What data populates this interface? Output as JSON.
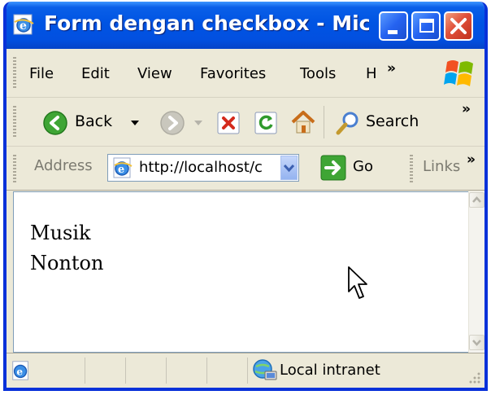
{
  "window": {
    "title": "Form dengan checkbox - Micr...",
    "title_bar_color": "#0054e3",
    "close_button_color": "#e0503a"
  },
  "menubar": {
    "items": [
      "File",
      "Edit",
      "View",
      "Favorites",
      "Tools",
      "H"
    ],
    "overflow_glyph": "»"
  },
  "toolbar": {
    "back_label": "Back",
    "search_label": "Search",
    "overflow_glyph": "»",
    "icons": [
      "back-arrow-icon",
      "forward-arrow-icon",
      "stop-icon",
      "refresh-icon",
      "home-icon",
      "search-icon"
    ]
  },
  "addressbar": {
    "label": "Address",
    "url": "http://localhost/c",
    "go_label": "Go",
    "links_label": "Links",
    "overflow_glyph": "»"
  },
  "content": {
    "lines": [
      "Musik",
      "Nonton"
    ]
  },
  "statusbar": {
    "zone": "Local intranet"
  }
}
